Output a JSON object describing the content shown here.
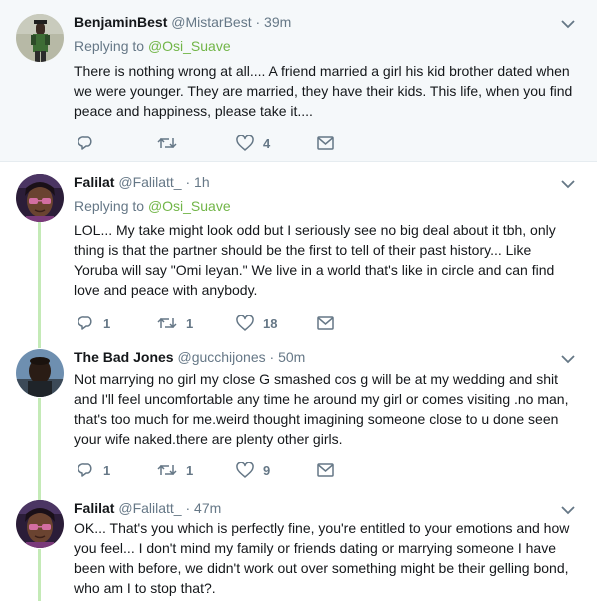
{
  "tweets": [
    {
      "name": "BenjaminBest",
      "handle": "@MistarBest",
      "time": "· 39m",
      "replying_label": "Replying to",
      "replying_to": "@Osi_Suave",
      "text": "There is nothing wrong at all.... A friend married a girl his kid brother dated when we were younger. They are married, they have their kids. This life, when you find peace and happiness, please take it....",
      "replies": "",
      "retweets": "",
      "likes": "4"
    },
    {
      "name": "Falilat",
      "handle": "@Falilatt_",
      "time": "· 1h",
      "replying_label": "Replying to",
      "replying_to": "@Osi_Suave",
      "text": "LOL... My take might look odd but I seriously see no big deal about it tbh, only thing is that the partner should be the first to tell of their past history... Like Yoruba will say \"Omi leyan.\" We live in a world that's like in circle and can find love and peace with anybody.",
      "replies": "1",
      "retweets": "1",
      "likes": "18"
    },
    {
      "name": "The Bad Jones",
      "handle": "@gucchijones",
      "time": "· 50m",
      "text": "Not marrying no girl my close G smashed cos g will be at my wedding and shit and I'll feel uncomfortable any time he around my girl or comes visiting .no man, that's too much for me.weird thought imagining someone close to u done seen your wife naked.there are plenty other girls.",
      "replies": "1",
      "retweets": "1",
      "likes": "9"
    },
    {
      "name": "Falilat",
      "handle": "@Falilatt_",
      "time": "· 47m",
      "text": "OK... That's you which is perfectly fine, you're entitled to your emotions and how you feel... I don't mind my family or friends dating or marrying someone I have been with before, we didn't work out over something might be their gelling bond, who am I to stop that?."
    }
  ],
  "colors": {
    "background_highlight": "#f5f8fa",
    "text": "#14171a",
    "secondary": "#657786",
    "mention": "#71b547",
    "thread_line": "#c4eab7",
    "divider": "#e6ecf0"
  },
  "icons": [
    "reply-icon",
    "retweet-icon",
    "like-icon",
    "dm-icon",
    "chevron-down-icon"
  ]
}
